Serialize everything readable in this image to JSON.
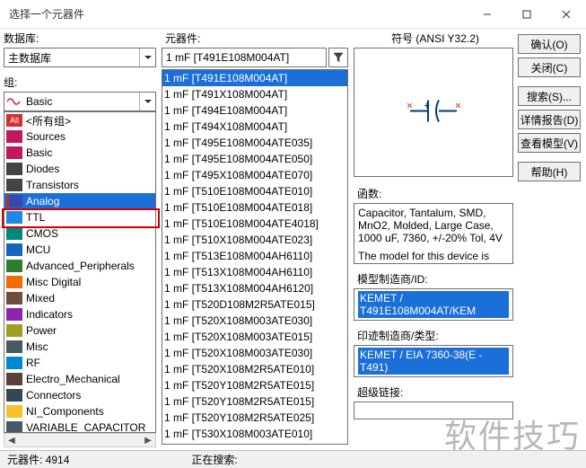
{
  "window": {
    "title": "选择一个元器件"
  },
  "labels": {
    "database": "数据库:",
    "group": "组:",
    "component": "元器件:",
    "symbol": "符号 (ANSI Y32.2)",
    "function": "函数:",
    "model_mfr_id": "模型制造商/ID:",
    "footprint_mfr_type": "印迹制造商/类型:",
    "hyperlink": "超级链接:"
  },
  "buttons": {
    "ok": "确认(O)",
    "close": "关闭(C)",
    "search": "搜索(S)...",
    "detail_report": "详情报告(D)",
    "view_model": "查看模型(V)",
    "help": "帮助(H)"
  },
  "database_combo": {
    "value": "主数据库"
  },
  "group_combo": {
    "value": "Basic"
  },
  "group_list": [
    {
      "label": "<所有组>",
      "icon": "all"
    },
    {
      "label": "Sources",
      "icon": "sine"
    },
    {
      "label": "Basic",
      "icon": "sine"
    },
    {
      "label": "Diodes",
      "icon": "diode"
    },
    {
      "label": "Transistors",
      "icon": "diode"
    },
    {
      "label": "Analog",
      "icon": "tri",
      "selected": true
    },
    {
      "label": "TTL",
      "icon": "ttl"
    },
    {
      "label": "CMOS",
      "icon": "cmos"
    },
    {
      "label": "MCU",
      "icon": "mcu"
    },
    {
      "label": "Advanced_Peripherals",
      "icon": "adv"
    },
    {
      "label": "Misc Digital",
      "icon": "miscd"
    },
    {
      "label": "Mixed",
      "icon": "mix"
    },
    {
      "label": "Indicators",
      "icon": "ind"
    },
    {
      "label": "Power",
      "icon": "pwr"
    },
    {
      "label": "Misc",
      "icon": "misc"
    },
    {
      "label": "RF",
      "icon": "rf"
    },
    {
      "label": "Electro_Mechanical",
      "icon": "em"
    },
    {
      "label": "Connectors",
      "icon": "conn"
    },
    {
      "label": "NI_Components",
      "icon": "ni"
    },
    {
      "label": "VARIABLE_CAPACITOR",
      "icon": "misc"
    }
  ],
  "component_combo": {
    "value": "1 mF   [T491E108M004AT]"
  },
  "component_list": [
    {
      "label": "1 mF   [T491E108M004AT]",
      "selected": true
    },
    {
      "label": "1 mF   [T491X108M004AT]"
    },
    {
      "label": "1 mF   [T494E108M004AT]"
    },
    {
      "label": "1 mF   [T494X108M004AT]"
    },
    {
      "label": "1 mF   [T495E108M004ATE035]"
    },
    {
      "label": "1 mF   [T495E108M004ATE050]"
    },
    {
      "label": "1 mF   [T495X108M004ATE070]"
    },
    {
      "label": "1 mF   [T510E108M004ATE010]"
    },
    {
      "label": "1 mF   [T510E108M004ATE018]"
    },
    {
      "label": "1 mF   [T510E108M004ATE4018]"
    },
    {
      "label": "1 mF   [T510X108M004ATE023]"
    },
    {
      "label": "1 mF   [T513E108M004AH6110]"
    },
    {
      "label": "1 mF   [T513X108M004AH6110]"
    },
    {
      "label": "1 mF   [T513X108M004AH6120]"
    },
    {
      "label": "1 mF   [T520D108M2R5ATE015]"
    },
    {
      "label": "1 mF   [T520X108M003ATE030]"
    },
    {
      "label": "1 mF   [T520X108M003ATE015]"
    },
    {
      "label": "1 mF   [T520X108M003ATE030]"
    },
    {
      "label": "1 mF   [T520X108M2R5ATE010]"
    },
    {
      "label": "1 mF   [T520Y108M2R5ATE015]"
    },
    {
      "label": "1 mF   [T520Y108M2R5ATE015]"
    },
    {
      "label": "1 mF   [T520Y108M2R5ATE025]"
    },
    {
      "label": "1 mF   [T530X108M003ATE010]"
    }
  ],
  "function_text": {
    "line1": "Capacitor, Tantalum, SMD, MnO2, Molded, Large Case, 1000 uF, 7360, +/-20% Tol, 4V",
    "line2": "The model for this device is designed to be most accurate at the following conditions"
  },
  "model_mfr_value": "KEMET / T491E108M004AT/KEM",
  "footprint_value": "KEMET / EIA 7360-38(E - T491)",
  "status": {
    "count_label": "元器件:",
    "count_value": "4914",
    "searching": "正在搜索:"
  },
  "watermark": "软件技巧"
}
